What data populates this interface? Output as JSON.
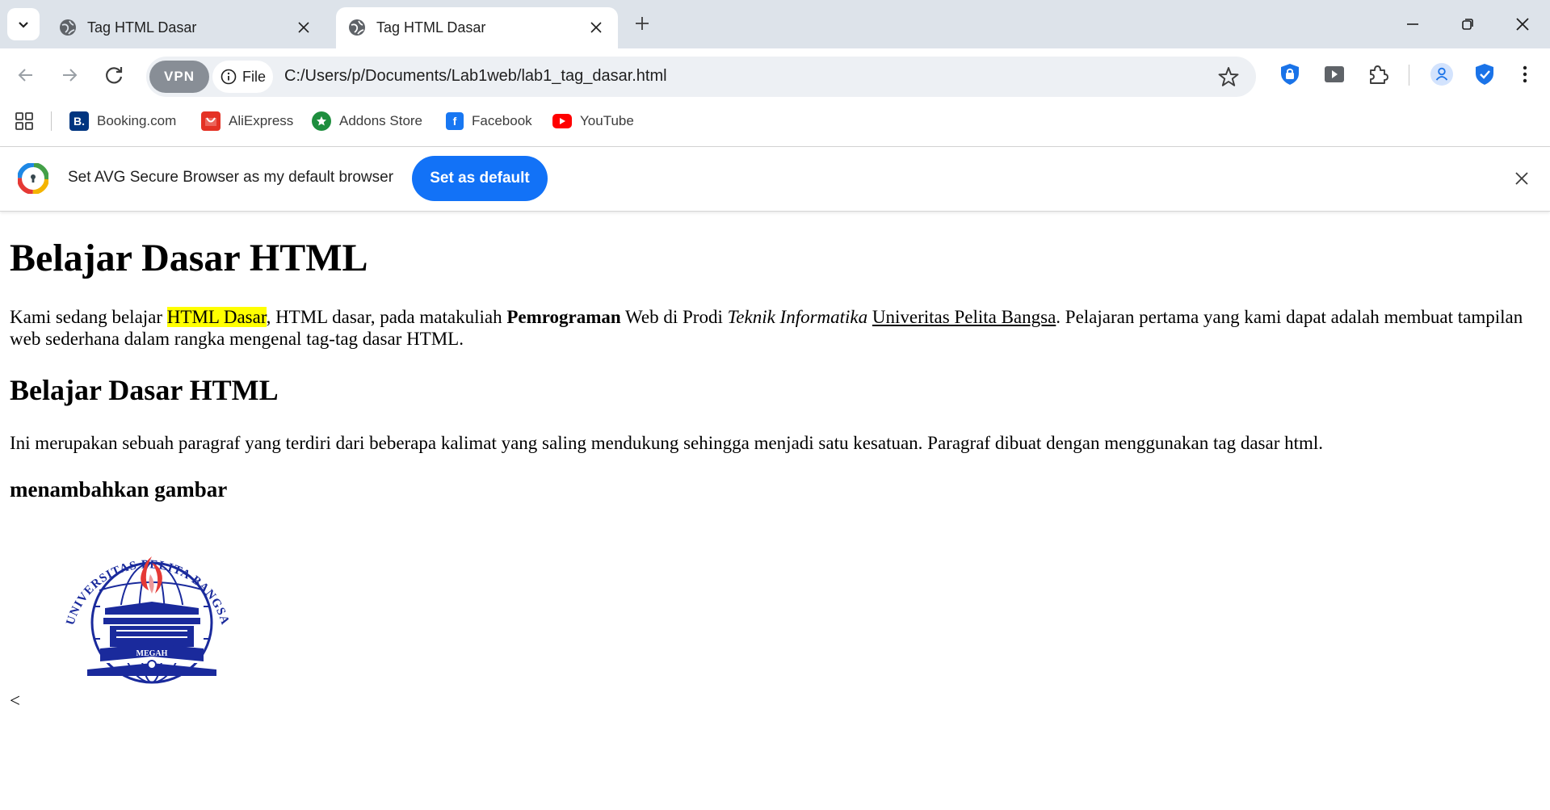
{
  "tabs": [
    {
      "title": "Tag HTML Dasar",
      "active": false
    },
    {
      "title": "Tag HTML Dasar",
      "active": true
    }
  ],
  "address_bar": {
    "vpn_label": "VPN",
    "scheme_label": "File",
    "url": "C:/Users/p/Documents/Lab1web/lab1_tag_dasar.html"
  },
  "bookmarks": [
    {
      "label": "Booking.com",
      "icon": "booking-icon",
      "color": "#003580"
    },
    {
      "label": "AliExpress",
      "icon": "aliexpress-icon",
      "color": "#e43225"
    },
    {
      "label": "Addons Store",
      "icon": "addons-store-icon",
      "color": "#1e8e3e"
    },
    {
      "label": "Facebook",
      "icon": "facebook-icon",
      "color": "#1877f2"
    },
    {
      "label": "YouTube",
      "icon": "youtube-icon",
      "color": "#ff0000"
    }
  ],
  "infobar": {
    "message": "Set AVG Secure Browser as my default browser",
    "button_label": "Set as default",
    "button_color": "#1272f7"
  },
  "content": {
    "heading1": "Belajar Dasar HTML",
    "p1": {
      "t1": "Kami sedang belajar ",
      "highlight": "HTML Dasar",
      "t2": ", HTML dasar, pada matakuliah ",
      "bold": "Pemrograman",
      "t3": " Web di Prodi ",
      "italic": "Teknik Informatika",
      "t4": " ",
      "underline": "Univeritas Pelita Bangsa",
      "t5": ". Pelajaran pertama yang kami dapat adalah membuat tampilan web sederhana dalam rangka mengenal tag-tag dasar HTML."
    },
    "heading2": "Belajar Dasar HTML",
    "p2": "Ini merupakan sebuah paragraf yang terdiri dari beberapa kalimat yang saling mendukung sehingga menjadi satu kesatuan. Paragraf dibuat dengan menggunakan tag dasar html.",
    "heading3": "menambahkan gambar",
    "logo": {
      "arc_text": "UNIVERSITAS PELITA BANGSA",
      "motto": "MEGAH",
      "color": "#1a2a9c"
    },
    "trailing_text": "<"
  },
  "colors": {
    "tabstrip": "#dde3ea",
    "highlight": "#ffff00",
    "accent_blue": "#1272f7"
  }
}
